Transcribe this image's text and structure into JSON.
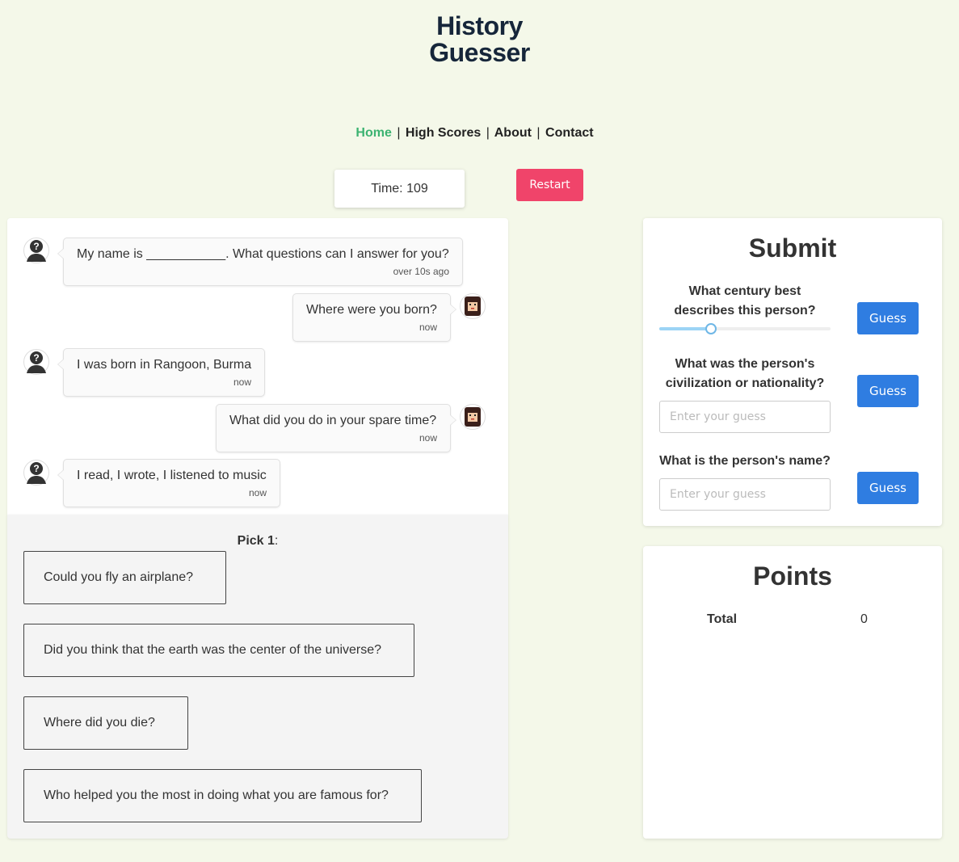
{
  "logo": {
    "line1": "History",
    "line2": "Guesser"
  },
  "nav": {
    "items": [
      "Home",
      "High Scores",
      "About",
      "Contact"
    ],
    "active": "Home",
    "separator": "|"
  },
  "timer": {
    "text": "Time: 109"
  },
  "restart_label": "Restart",
  "chat": {
    "messages": [
      {
        "from": "historical-figure",
        "text": "My name is ___________. What questions can I answer for you?",
        "time": "over 10s ago"
      },
      {
        "from": "player",
        "text": "Where were you born?",
        "time": "now"
      },
      {
        "from": "historical-figure",
        "text": "I was born in Rangoon, Burma",
        "time": "now"
      },
      {
        "from": "player",
        "text": "What did you do in your spare time?",
        "time": "now"
      },
      {
        "from": "historical-figure",
        "text": "I read, I wrote, I listened to music",
        "time": "now"
      }
    ]
  },
  "picks": {
    "title_bold": "Pick 1",
    "title_suffix": ":",
    "options": [
      "Could you fly an airplane?",
      "Did you think that the earth was the center of the universe?",
      "Where did you die?",
      "Who helped you the most in doing what you are famous for?"
    ]
  },
  "submit": {
    "title": "Submit",
    "century_question_line1": "What century best",
    "century_question_line2": "describes this person?",
    "century_slider_fraction": 0.3,
    "civilization_question_line1": "What was the person's",
    "civilization_question_line2": "civilization or nationality?",
    "name_question": "What is the person's name?",
    "guess_label": "Guess",
    "input_placeholder": "Enter your guess"
  },
  "points": {
    "title": "Points",
    "total_label": "Total",
    "total_value": "0"
  },
  "colors": {
    "background": "#f4f8e9",
    "logo": "#16263a",
    "nav_active": "#3cb371",
    "restart": "#f0446a",
    "guess_button": "#2f7de1"
  }
}
